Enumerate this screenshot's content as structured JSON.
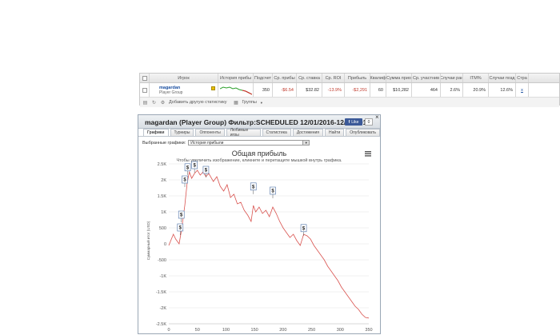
{
  "table": {
    "headers": [
      "",
      "Игрок",
      "История прибы",
      "Подсчет",
      "Ср. прибы",
      "Ср. ставка",
      "Ср. ROI",
      "Прибыль",
      "Квалиф",
      "Сумма прио",
      "Ср. участнив",
      "Случаи ран",
      "ITM%",
      "Случаи позд",
      "Стра"
    ],
    "row": {
      "player_name": "magardan",
      "player_group": "Player Group",
      "count": "350",
      "avg_profit": "-$6.54",
      "avg_stake": "$32.82",
      "avg_roi": "-13.9%",
      "profit": "-$2,291",
      "qualif": "60",
      "prize_sum": "$10,282",
      "avg_entrants": "464",
      "early": "2.6%",
      "itm": "20.9%",
      "late": "12.6%",
      "link": "x"
    },
    "toolbar": {
      "add_stat": "Добавить другую статистику",
      "groups": "Группы"
    }
  },
  "dialog": {
    "title": "magardan (Player Group) Фильтр:SCHEDULED 12/01/2016-12/20/2016",
    "fb_label": "Like",
    "fb_count": "0",
    "close": "×",
    "tabs": [
      "Графики",
      "Турниры",
      "Оппоненты",
      "Любимые игры",
      "Статистика",
      "Достижения",
      "Найти",
      "Опубликовать"
    ],
    "select_label": "Выбранные графики:",
    "select_value": "История прибыли"
  },
  "chart_data": {
    "type": "line",
    "title": "Общая прибыль",
    "subtitle": "Чтобы увеличить изображение, кликните и перетащите мышкой внутрь графика.",
    "ylabel": "Суммарный итог (USD)",
    "xlabel": "",
    "xlim": [
      0,
      350
    ],
    "ylim": [
      -2500,
      2500
    ],
    "x_ticks": [
      "0",
      "50",
      "100",
      "150",
      "200",
      "250",
      "300",
      "350"
    ],
    "y_ticks": [
      "2.5K",
      "2K",
      "1.5K",
      "1K",
      "500",
      "0",
      "-500",
      "-1K",
      "-1.5K",
      "-2K",
      "-2.5K"
    ],
    "color": "#d9534f",
    "series": [
      {
        "values": [
          [
            0,
            -50
          ],
          [
            8,
            300
          ],
          [
            12,
            150
          ],
          [
            18,
            0
          ],
          [
            22,
            400
          ],
          [
            28,
            1200
          ],
          [
            32,
            1900
          ],
          [
            36,
            2250
          ],
          [
            40,
            2050
          ],
          [
            45,
            2200
          ],
          [
            50,
            2300
          ],
          [
            55,
            2150
          ],
          [
            60,
            2250
          ],
          [
            65,
            2100
          ],
          [
            70,
            2200
          ],
          [
            78,
            1950
          ],
          [
            84,
            2100
          ],
          [
            90,
            1800
          ],
          [
            96,
            1650
          ],
          [
            102,
            1850
          ],
          [
            108,
            1450
          ],
          [
            114,
            1550
          ],
          [
            120,
            1250
          ],
          [
            126,
            1300
          ],
          [
            132,
            1050
          ],
          [
            138,
            900
          ],
          [
            144,
            700
          ],
          [
            148,
            1200
          ],
          [
            152,
            1000
          ],
          [
            158,
            1150
          ],
          [
            164,
            950
          ],
          [
            170,
            1050
          ],
          [
            176,
            850
          ],
          [
            182,
            1150
          ],
          [
            188,
            950
          ],
          [
            194,
            700
          ],
          [
            200,
            500
          ],
          [
            206,
            350
          ],
          [
            212,
            200
          ],
          [
            218,
            300
          ],
          [
            224,
            100
          ],
          [
            230,
            -50
          ],
          [
            236,
            300
          ],
          [
            242,
            250
          ],
          [
            248,
            150
          ],
          [
            254,
            -50
          ],
          [
            260,
            -200
          ],
          [
            266,
            -350
          ],
          [
            272,
            -500
          ],
          [
            278,
            -700
          ],
          [
            284,
            -850
          ],
          [
            290,
            -1000
          ],
          [
            296,
            -1150
          ],
          [
            302,
            -1350
          ],
          [
            308,
            -1500
          ],
          [
            314,
            -1650
          ],
          [
            320,
            -1800
          ],
          [
            326,
            -1950
          ],
          [
            332,
            -2050
          ],
          [
            338,
            -2200
          ],
          [
            344,
            -2300
          ],
          [
            350,
            -2320
          ]
        ]
      }
    ],
    "markers": [
      {
        "x": 20,
        "y": 400,
        "label": "$"
      },
      {
        "x": 22,
        "y": 800,
        "label": "$"
      },
      {
        "x": 28,
        "y": 1900,
        "label": "$"
      },
      {
        "x": 33,
        "y": 2280,
        "label": "$"
      },
      {
        "x": 45,
        "y": 2350,
        "label": "$"
      },
      {
        "x": 65,
        "y": 2200,
        "label": "$"
      },
      {
        "x": 148,
        "y": 1680,
        "label": "$"
      },
      {
        "x": 182,
        "y": 1550,
        "label": "$"
      },
      {
        "x": 236,
        "y": 380,
        "label": "$"
      }
    ]
  }
}
